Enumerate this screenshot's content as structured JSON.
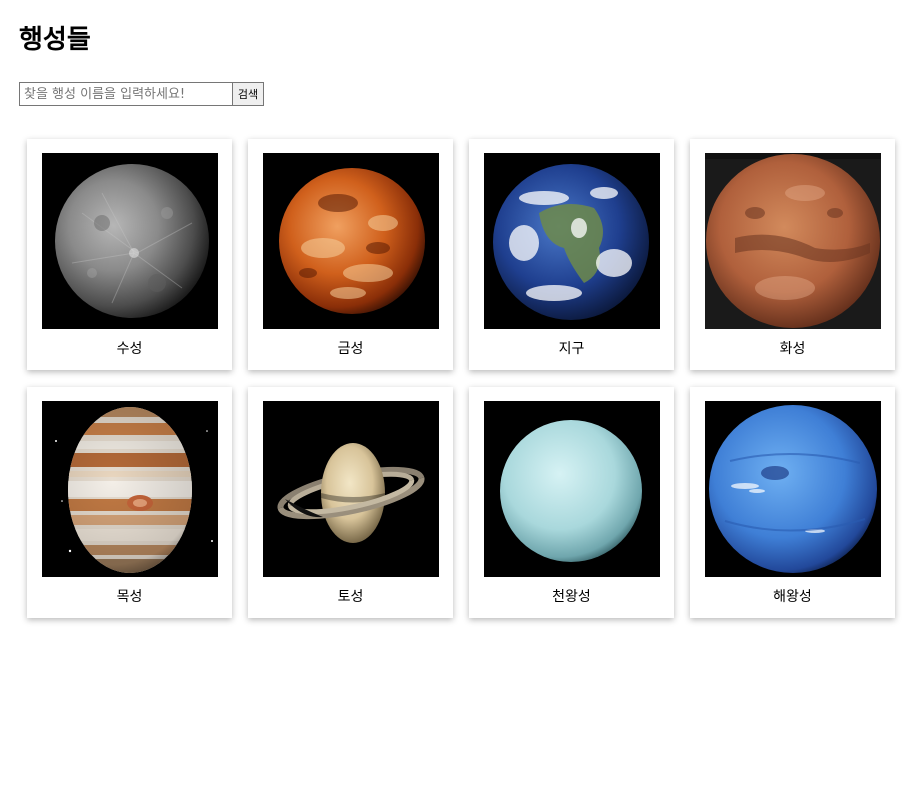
{
  "page": {
    "title": "행성들"
  },
  "search": {
    "placeholder": "찾을 행성 이름을 입력하세요!",
    "value": "",
    "button_label": "검색"
  },
  "planets": [
    {
      "name": "수성",
      "icon": "mercury-image"
    },
    {
      "name": "금성",
      "icon": "venus-image"
    },
    {
      "name": "지구",
      "icon": "earth-image"
    },
    {
      "name": "화성",
      "icon": "mars-image"
    },
    {
      "name": "목성",
      "icon": "jupiter-image"
    },
    {
      "name": "토성",
      "icon": "saturn-image"
    },
    {
      "name": "천왕성",
      "icon": "uranus-image"
    },
    {
      "name": "해왕성",
      "icon": "neptune-image"
    }
  ]
}
